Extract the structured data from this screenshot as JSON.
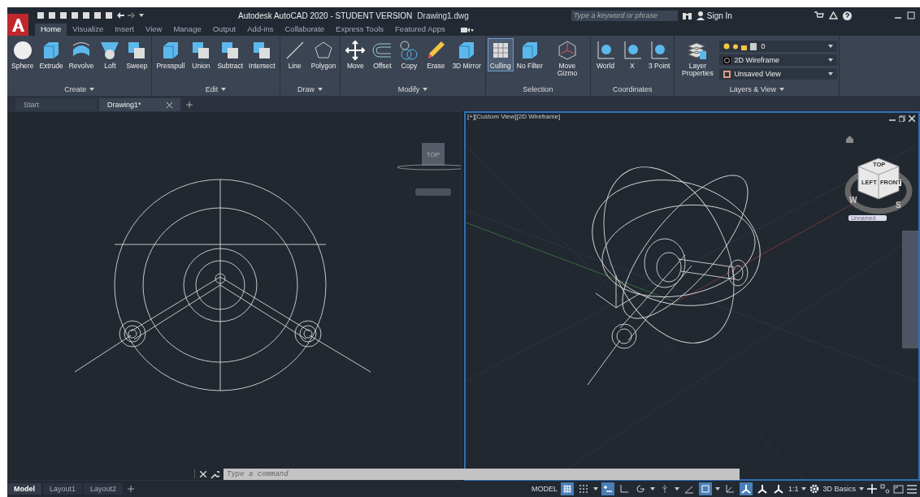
{
  "title_bar": {
    "title": "Autodesk AutoCAD 2020 - STUDENT VERSION",
    "file": "Drawing1.dwg",
    "search": {
      "placeholder": "Type a keyword or phrase"
    },
    "sign_in": "Sign In"
  },
  "ribbon_tabs": [
    {
      "label": "Home",
      "selected": true
    },
    {
      "label": "Visualize",
      "selected": false
    },
    {
      "label": "Insert",
      "selected": false
    },
    {
      "label": "View",
      "selected": false
    },
    {
      "label": "Manage",
      "selected": false
    },
    {
      "label": "Output",
      "selected": false
    },
    {
      "label": "Add-ins",
      "selected": false
    },
    {
      "label": "Collaborate",
      "selected": false
    },
    {
      "label": "Express Tools",
      "selected": false
    },
    {
      "label": "Featured Apps",
      "selected": false
    }
  ],
  "ribbon_panels": [
    {
      "title": "Create",
      "menu": true,
      "buttons": [
        {
          "label": "Sphere",
          "kind": "sphere"
        },
        {
          "label": "Extrude",
          "kind": "cube"
        },
        {
          "label": "Revolve",
          "kind": "revolve"
        },
        {
          "label": "Loft",
          "kind": "loft"
        },
        {
          "label": "Sweep",
          "kind": "cubes"
        }
      ]
    },
    {
      "title": "Edit",
      "menu": true,
      "buttons": [
        {
          "label": "Presspull",
          "kind": "cube"
        },
        {
          "label": "Union",
          "kind": "cubes"
        },
        {
          "label": "Subtract",
          "kind": "cubes"
        },
        {
          "label": "Intersect",
          "kind": "cubes"
        }
      ]
    },
    {
      "title": "Draw",
      "menu": true,
      "buttons": [
        {
          "label": "Line",
          "kind": "line"
        },
        {
          "label": "Polygon",
          "kind": "polygon"
        }
      ]
    },
    {
      "title": "Modify",
      "menu": true,
      "buttons": [
        {
          "label": "Move",
          "kind": "move"
        },
        {
          "label": "Offset",
          "kind": "offset"
        },
        {
          "label": "Copy",
          "kind": "copy"
        },
        {
          "label": "Erase",
          "kind": "erase"
        },
        {
          "label": "3D Mirror",
          "kind": "cube"
        }
      ]
    },
    {
      "title": "Selection",
      "menu": false,
      "buttons": [
        {
          "label": "Culling",
          "kind": "culling",
          "on": true
        },
        {
          "label": "No Filter",
          "kind": "cube",
          "on": false
        },
        {
          "label": "Move Gizmo",
          "kind": "gizmo",
          "on": false
        }
      ]
    },
    {
      "title": "Coordinates",
      "menu": false,
      "buttons": [
        {
          "label": "World",
          "kind": "ucs"
        },
        {
          "label": "X",
          "kind": "ucs"
        },
        {
          "label": "3 Point",
          "kind": "ucs"
        }
      ]
    },
    {
      "title": "Layers & View",
      "menu": true,
      "buttons": [
        {
          "label": "Layer Properties",
          "kind": "layers"
        }
      ]
    }
  ],
  "layers_view": {
    "layer": "0",
    "visual_style": "2D Wireframe",
    "view": "Unsaved View"
  },
  "doc_tabs": [
    {
      "label": "Start",
      "selected": false
    },
    {
      "label": "Drawing1*",
      "selected": true
    }
  ],
  "viewports": [
    {
      "kind": "top",
      "active": false,
      "cube_faces": [
        "TOP"
      ]
    },
    {
      "kind": "iso",
      "active": true,
      "label": "[+][Custom View][2D Wireframe]",
      "cube_faces": [
        "TOP",
        "LEFT",
        "FRONT"
      ],
      "compass": [
        "W",
        "S"
      ],
      "ucs_menu": "Unnamed"
    }
  ],
  "command_line": {
    "placeholder": "Type a command"
  },
  "layout_tabs": [
    {
      "label": "Model",
      "selected": true
    },
    {
      "label": "Layout1",
      "selected": false
    },
    {
      "label": "Layout2",
      "selected": false
    }
  ],
  "status_items": [
    {
      "kind": "text",
      "label": "MODEL"
    },
    {
      "kind": "grid",
      "on": true
    },
    {
      "kind": "dots",
      "on": false
    },
    {
      "kind": "caret"
    },
    {
      "kind": "infer",
      "on": true
    },
    {
      "kind": "ortho",
      "on": false
    },
    {
      "kind": "polar",
      "on": false
    },
    {
      "kind": "caret"
    },
    {
      "kind": "iso",
      "on": false
    },
    {
      "kind": "caret"
    },
    {
      "kind": "angle",
      "on": false
    },
    {
      "kind": "osnap",
      "on": true
    },
    {
      "kind": "caret"
    },
    {
      "kind": "ucs",
      "on": false
    },
    {
      "kind": "anno",
      "on": true
    },
    {
      "kind": "anno",
      "on": false
    },
    {
      "kind": "anno",
      "on": false
    },
    {
      "kind": "text",
      "label": "1:1"
    },
    {
      "kind": "caret"
    },
    {
      "kind": "gear"
    },
    {
      "kind": "text",
      "label": "3D Basics"
    },
    {
      "kind": "caret"
    },
    {
      "kind": "plus"
    },
    {
      "kind": "units"
    },
    {
      "kind": "fullscreen"
    },
    {
      "kind": "menu"
    }
  ]
}
